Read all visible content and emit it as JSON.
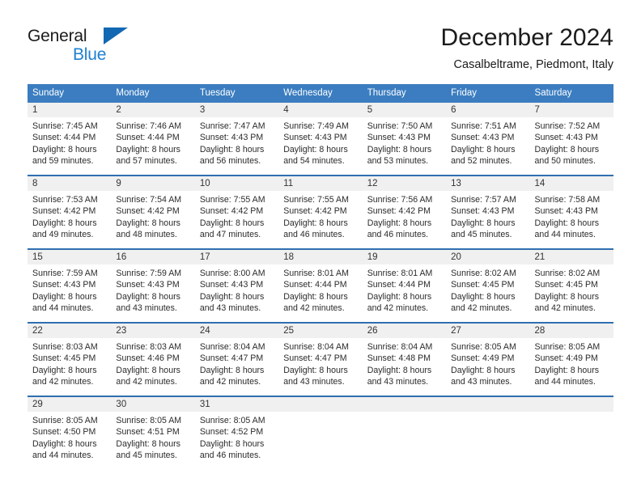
{
  "brand": {
    "name_dark": "General",
    "name_blue": "Blue",
    "flag_icon": "triangle-flag-icon",
    "accent_color": "#1268b3",
    "blue_text_color": "#2081d0"
  },
  "header": {
    "title": "December 2024",
    "subtitle": "Casalbeltrame, Piedmont, Italy"
  },
  "theme": {
    "header_bg": "#3b7dc0",
    "week_divider": "#2f6fb0",
    "date_band_bg": "#f0f0f0",
    "text": "#2b2b2b"
  },
  "weekdays": [
    "Sunday",
    "Monday",
    "Tuesday",
    "Wednesday",
    "Thursday",
    "Friday",
    "Saturday"
  ],
  "weeks": [
    [
      {
        "day": "1",
        "sunrise": "Sunrise: 7:45 AM",
        "sunset": "Sunset: 4:44 PM",
        "daylight1": "Daylight: 8 hours",
        "daylight2": "and 59 minutes."
      },
      {
        "day": "2",
        "sunrise": "Sunrise: 7:46 AM",
        "sunset": "Sunset: 4:44 PM",
        "daylight1": "Daylight: 8 hours",
        "daylight2": "and 57 minutes."
      },
      {
        "day": "3",
        "sunrise": "Sunrise: 7:47 AM",
        "sunset": "Sunset: 4:43 PM",
        "daylight1": "Daylight: 8 hours",
        "daylight2": "and 56 minutes."
      },
      {
        "day": "4",
        "sunrise": "Sunrise: 7:49 AM",
        "sunset": "Sunset: 4:43 PM",
        "daylight1": "Daylight: 8 hours",
        "daylight2": "and 54 minutes."
      },
      {
        "day": "5",
        "sunrise": "Sunrise: 7:50 AM",
        "sunset": "Sunset: 4:43 PM",
        "daylight1": "Daylight: 8 hours",
        "daylight2": "and 53 minutes."
      },
      {
        "day": "6",
        "sunrise": "Sunrise: 7:51 AM",
        "sunset": "Sunset: 4:43 PM",
        "daylight1": "Daylight: 8 hours",
        "daylight2": "and 52 minutes."
      },
      {
        "day": "7",
        "sunrise": "Sunrise: 7:52 AM",
        "sunset": "Sunset: 4:43 PM",
        "daylight1": "Daylight: 8 hours",
        "daylight2": "and 50 minutes."
      }
    ],
    [
      {
        "day": "8",
        "sunrise": "Sunrise: 7:53 AM",
        "sunset": "Sunset: 4:42 PM",
        "daylight1": "Daylight: 8 hours",
        "daylight2": "and 49 minutes."
      },
      {
        "day": "9",
        "sunrise": "Sunrise: 7:54 AM",
        "sunset": "Sunset: 4:42 PM",
        "daylight1": "Daylight: 8 hours",
        "daylight2": "and 48 minutes."
      },
      {
        "day": "10",
        "sunrise": "Sunrise: 7:55 AM",
        "sunset": "Sunset: 4:42 PM",
        "daylight1": "Daylight: 8 hours",
        "daylight2": "and 47 minutes."
      },
      {
        "day": "11",
        "sunrise": "Sunrise: 7:55 AM",
        "sunset": "Sunset: 4:42 PM",
        "daylight1": "Daylight: 8 hours",
        "daylight2": "and 46 minutes."
      },
      {
        "day": "12",
        "sunrise": "Sunrise: 7:56 AM",
        "sunset": "Sunset: 4:42 PM",
        "daylight1": "Daylight: 8 hours",
        "daylight2": "and 46 minutes."
      },
      {
        "day": "13",
        "sunrise": "Sunrise: 7:57 AM",
        "sunset": "Sunset: 4:43 PM",
        "daylight1": "Daylight: 8 hours",
        "daylight2": "and 45 minutes."
      },
      {
        "day": "14",
        "sunrise": "Sunrise: 7:58 AM",
        "sunset": "Sunset: 4:43 PM",
        "daylight1": "Daylight: 8 hours",
        "daylight2": "and 44 minutes."
      }
    ],
    [
      {
        "day": "15",
        "sunrise": "Sunrise: 7:59 AM",
        "sunset": "Sunset: 4:43 PM",
        "daylight1": "Daylight: 8 hours",
        "daylight2": "and 44 minutes."
      },
      {
        "day": "16",
        "sunrise": "Sunrise: 7:59 AM",
        "sunset": "Sunset: 4:43 PM",
        "daylight1": "Daylight: 8 hours",
        "daylight2": "and 43 minutes."
      },
      {
        "day": "17",
        "sunrise": "Sunrise: 8:00 AM",
        "sunset": "Sunset: 4:43 PM",
        "daylight1": "Daylight: 8 hours",
        "daylight2": "and 43 minutes."
      },
      {
        "day": "18",
        "sunrise": "Sunrise: 8:01 AM",
        "sunset": "Sunset: 4:44 PM",
        "daylight1": "Daylight: 8 hours",
        "daylight2": "and 42 minutes."
      },
      {
        "day": "19",
        "sunrise": "Sunrise: 8:01 AM",
        "sunset": "Sunset: 4:44 PM",
        "daylight1": "Daylight: 8 hours",
        "daylight2": "and 42 minutes."
      },
      {
        "day": "20",
        "sunrise": "Sunrise: 8:02 AM",
        "sunset": "Sunset: 4:45 PM",
        "daylight1": "Daylight: 8 hours",
        "daylight2": "and 42 minutes."
      },
      {
        "day": "21",
        "sunrise": "Sunrise: 8:02 AM",
        "sunset": "Sunset: 4:45 PM",
        "daylight1": "Daylight: 8 hours",
        "daylight2": "and 42 minutes."
      }
    ],
    [
      {
        "day": "22",
        "sunrise": "Sunrise: 8:03 AM",
        "sunset": "Sunset: 4:45 PM",
        "daylight1": "Daylight: 8 hours",
        "daylight2": "and 42 minutes."
      },
      {
        "day": "23",
        "sunrise": "Sunrise: 8:03 AM",
        "sunset": "Sunset: 4:46 PM",
        "daylight1": "Daylight: 8 hours",
        "daylight2": "and 42 minutes."
      },
      {
        "day": "24",
        "sunrise": "Sunrise: 8:04 AM",
        "sunset": "Sunset: 4:47 PM",
        "daylight1": "Daylight: 8 hours",
        "daylight2": "and 42 minutes."
      },
      {
        "day": "25",
        "sunrise": "Sunrise: 8:04 AM",
        "sunset": "Sunset: 4:47 PM",
        "daylight1": "Daylight: 8 hours",
        "daylight2": "and 43 minutes."
      },
      {
        "day": "26",
        "sunrise": "Sunrise: 8:04 AM",
        "sunset": "Sunset: 4:48 PM",
        "daylight1": "Daylight: 8 hours",
        "daylight2": "and 43 minutes."
      },
      {
        "day": "27",
        "sunrise": "Sunrise: 8:05 AM",
        "sunset": "Sunset: 4:49 PM",
        "daylight1": "Daylight: 8 hours",
        "daylight2": "and 43 minutes."
      },
      {
        "day": "28",
        "sunrise": "Sunrise: 8:05 AM",
        "sunset": "Sunset: 4:49 PM",
        "daylight1": "Daylight: 8 hours",
        "daylight2": "and 44 minutes."
      }
    ],
    [
      {
        "day": "29",
        "sunrise": "Sunrise: 8:05 AM",
        "sunset": "Sunset: 4:50 PM",
        "daylight1": "Daylight: 8 hours",
        "daylight2": "and 44 minutes."
      },
      {
        "day": "30",
        "sunrise": "Sunrise: 8:05 AM",
        "sunset": "Sunset: 4:51 PM",
        "daylight1": "Daylight: 8 hours",
        "daylight2": "and 45 minutes."
      },
      {
        "day": "31",
        "sunrise": "Sunrise: 8:05 AM",
        "sunset": "Sunset: 4:52 PM",
        "daylight1": "Daylight: 8 hours",
        "daylight2": "and 46 minutes."
      },
      {
        "day": "",
        "sunrise": "",
        "sunset": "",
        "daylight1": "",
        "daylight2": ""
      },
      {
        "day": "",
        "sunrise": "",
        "sunset": "",
        "daylight1": "",
        "daylight2": ""
      },
      {
        "day": "",
        "sunrise": "",
        "sunset": "",
        "daylight1": "",
        "daylight2": ""
      },
      {
        "day": "",
        "sunrise": "",
        "sunset": "",
        "daylight1": "",
        "daylight2": ""
      }
    ]
  ]
}
